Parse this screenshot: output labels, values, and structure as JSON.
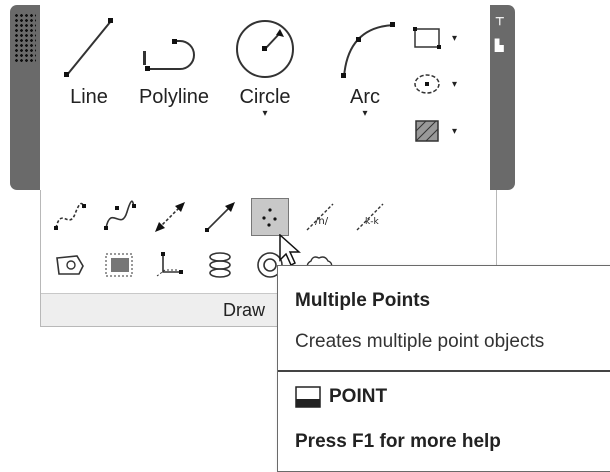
{
  "draw_panel": {
    "tools": [
      {
        "label": "Line",
        "icon": "line-icon"
      },
      {
        "label": "Polyline",
        "icon": "polyline-icon"
      },
      {
        "label": "Circle",
        "icon": "circle-icon",
        "has_dropdown": true
      },
      {
        "label": "Arc",
        "icon": "arc-icon",
        "has_dropdown": true
      }
    ],
    "small_tools": [
      {
        "icon": "rectangle-icon",
        "has_dropdown": true
      },
      {
        "icon": "ellipse-icon",
        "has_dropdown": true
      },
      {
        "icon": "hatch-icon",
        "has_dropdown": true
      }
    ],
    "title": "Draw",
    "dropdown_caret": "▾"
  },
  "expanded_panel": {
    "row1": [
      "spline-fit-icon",
      "spline-cv-icon",
      "construction-line-icon",
      "ray-icon",
      "multiple-points-icon",
      "divide-icon",
      "measure-icon"
    ],
    "row2": [
      "region-icon",
      "wipeout-icon",
      "3d-polyline-icon",
      "helix-icon",
      "donut-icon",
      "revision-cloud-icon"
    ],
    "selected": "multiple-points-icon"
  },
  "tooltip": {
    "title": "Multiple Points",
    "description": "Creates multiple point objects",
    "command": "POINT",
    "help": "Press F1 for more help"
  },
  "colors": {
    "panel_frame": "#6a6a6a",
    "selection": "#c8c8c8",
    "title_bar": "#eeeeee"
  }
}
